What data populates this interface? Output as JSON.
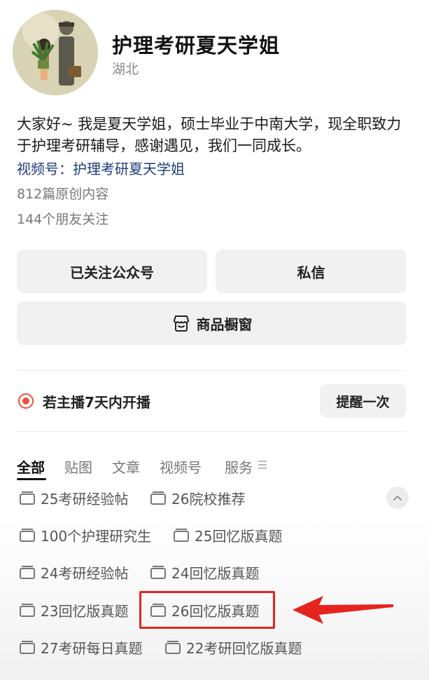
{
  "profile": {
    "name": "护理考研夏天学姐",
    "region": "湖北",
    "bio": "大家好~ 我是夏天学姐，硕士毕业于中南大学，现全职致力于护理考研辅导，感谢遇见，我们一同成长。",
    "channel_link": "视频号：护理考研夏天学姐",
    "original_count": "812篇原创内容",
    "friends_following": "144个朋友关注"
  },
  "actions": {
    "followed_label": "已关注公众号",
    "message_label": "私信",
    "shop_label": "商品橱窗",
    "shop_icon": "shop-storefront-icon"
  },
  "live": {
    "text": "若主播7天内开播",
    "remind_label": "提醒一次",
    "dot_color": "#f0503c"
  },
  "tabs": [
    {
      "label": "全部",
      "active": true
    },
    {
      "label": "贴图",
      "active": false
    },
    {
      "label": "文章",
      "active": false
    },
    {
      "label": "视频号",
      "active": false
    },
    {
      "label": "服务",
      "active": false
    }
  ],
  "collections": [
    {
      "label": "25考研经验帖"
    },
    {
      "label": "26院校推荐"
    },
    {
      "label": "100个护理研究生"
    },
    {
      "label": "25回忆版真题"
    },
    {
      "label": "24考研经验帖"
    },
    {
      "label": "24回忆版真题"
    },
    {
      "label": "23回忆版真题"
    },
    {
      "label": "26回忆版真题",
      "highlighted": true
    },
    {
      "label": "27考研每日真题"
    },
    {
      "label": "22考研回忆版真题"
    }
  ],
  "annotation": {
    "color": "#e52420"
  }
}
